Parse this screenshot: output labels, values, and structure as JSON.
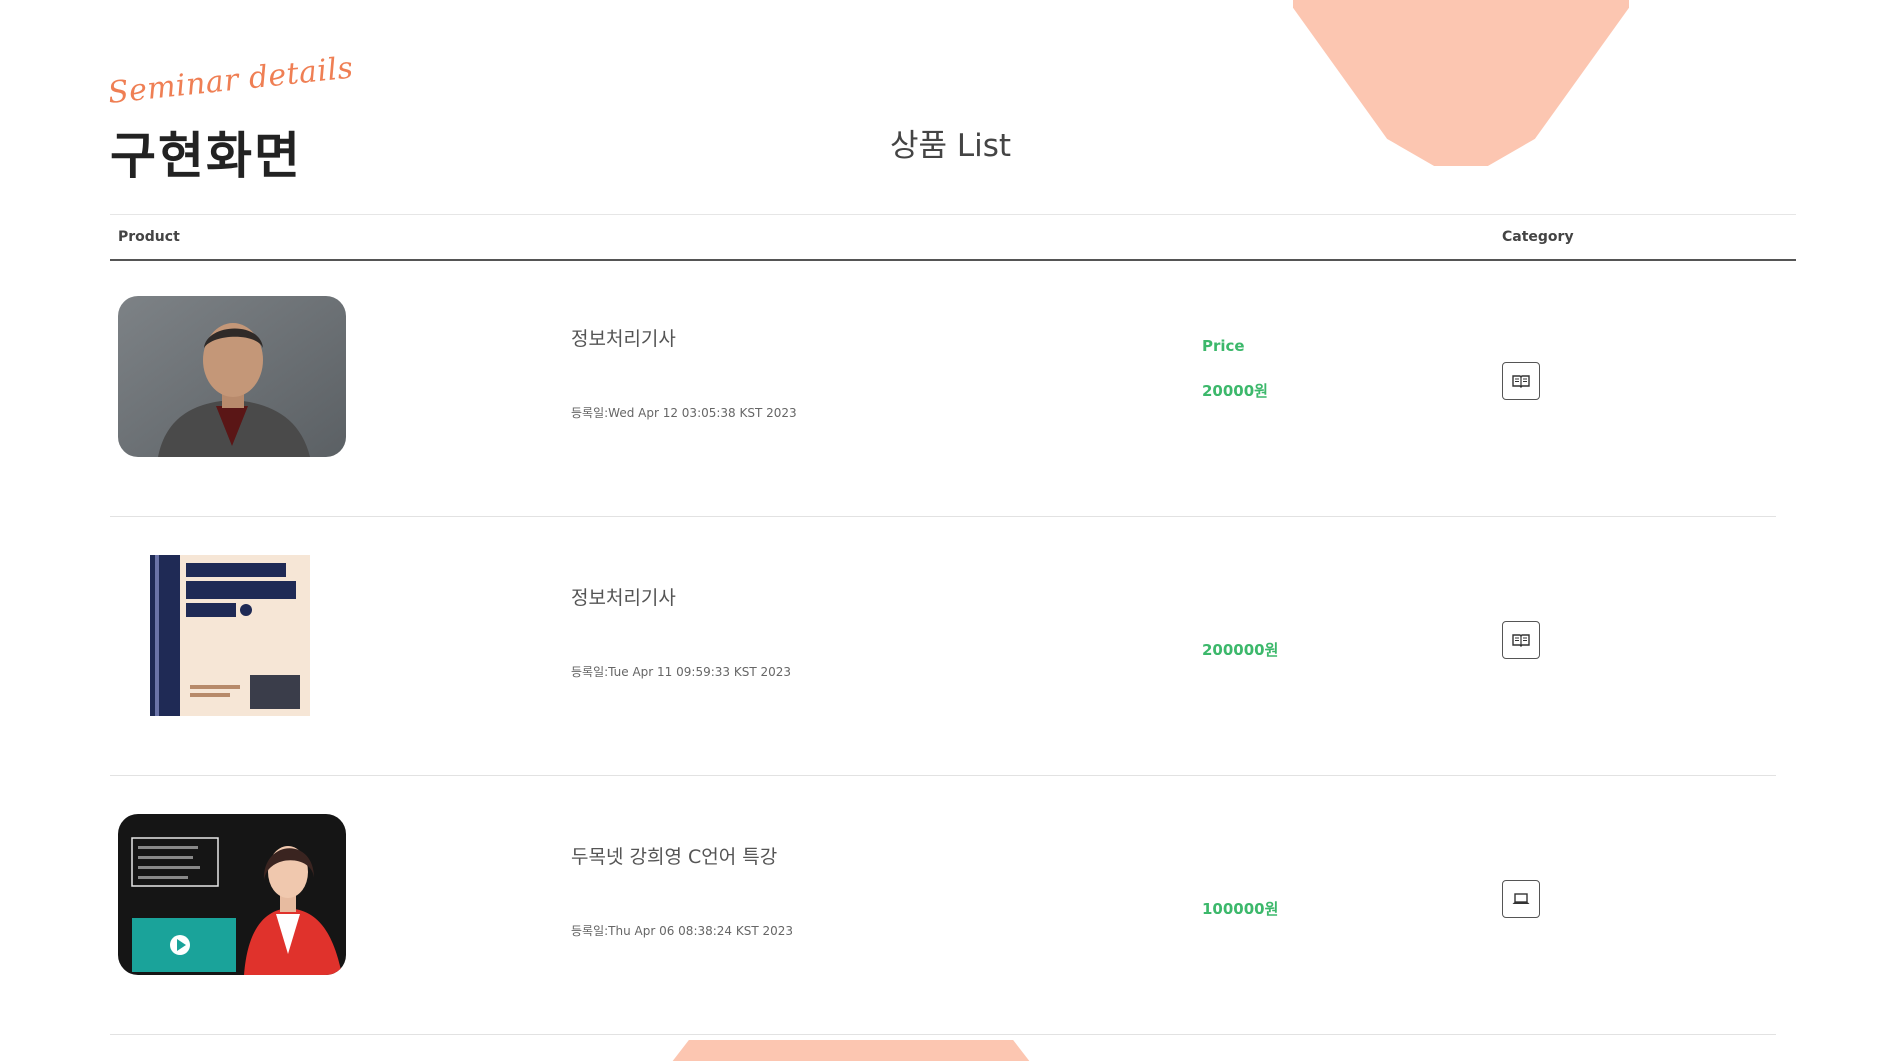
{
  "header": {
    "script_title": "Seminar details",
    "main_title": "구현화면",
    "list_title": "상품 List"
  },
  "table": {
    "columns": [
      "Product",
      "Price",
      "Category"
    ],
    "rows": [
      {
        "thumbnail": "portrait-man-icon",
        "name": "정보처리기사",
        "registered": "등록일:Wed Apr 12 03:05:38 KST 2023",
        "price": "20000원",
        "category_icon": "book-icon"
      },
      {
        "thumbnail": "book-cover-icon",
        "name": "정보처리기사",
        "registered": "등록일:Tue Apr 11 09:59:33 KST 2023",
        "price": "200000원",
        "category_icon": "book-icon"
      },
      {
        "thumbnail": "lecture-banner-icon",
        "name": "두목넷 강희영 C언어 특강",
        "registered": "등록일:Thu Apr 06 08:38:24 KST 2023",
        "price": "100000원",
        "category_icon": "laptop-icon"
      }
    ]
  },
  "colors": {
    "accent_peach": "#fcc6b1",
    "script_orange": "#ef7f54",
    "price_green": "#3cb86b"
  }
}
